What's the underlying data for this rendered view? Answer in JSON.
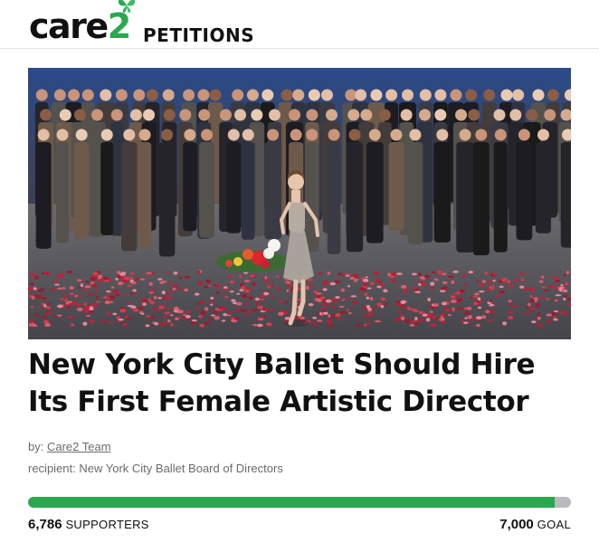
{
  "brand": {
    "word": "care",
    "number": "2",
    "section": "PETITIONS"
  },
  "petition": {
    "image_alt": "Ballerina on stage surrounded by rose petals with applauding dancers behind her",
    "title": "New York City Ballet Should Hire Its First Female Artistic Director",
    "by_label": "by:",
    "author": "Care2 Team",
    "recipient_label": "recipient:",
    "recipient": "New York City Ballet Board of Directors"
  },
  "progress": {
    "supporters": "6,786",
    "supporters_label": "SUPPORTERS",
    "goal": "7,000",
    "goal_label": "GOAL",
    "fraction": 0.9694
  },
  "colors": {
    "accent": "#2aa84f",
    "track": "#b9b9be"
  }
}
